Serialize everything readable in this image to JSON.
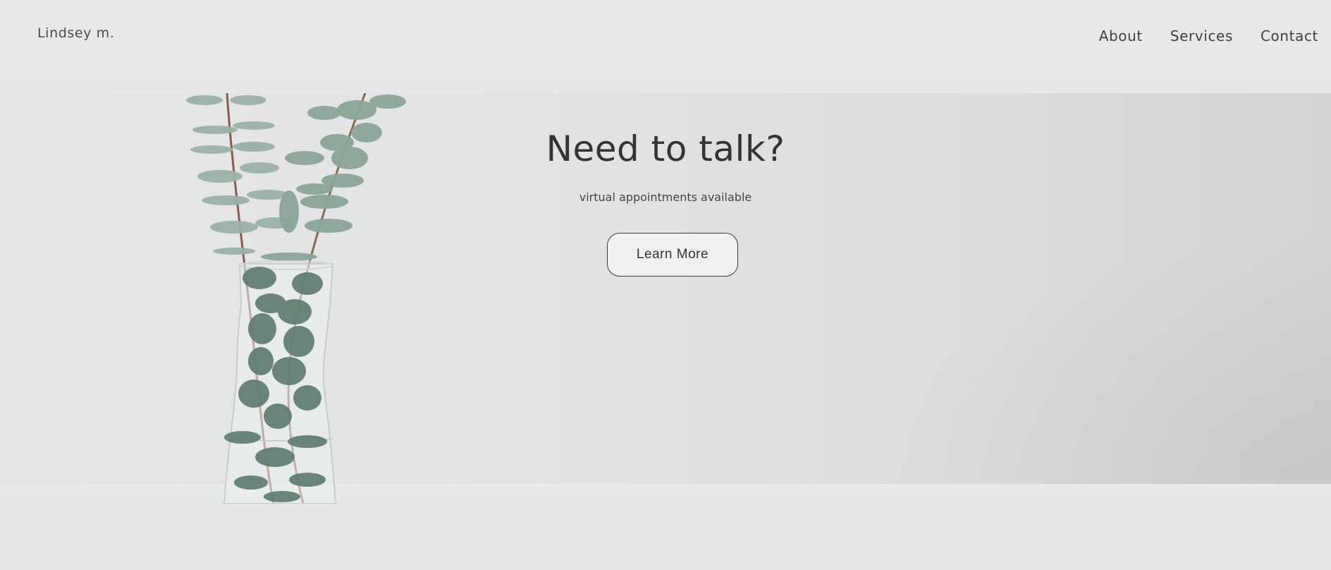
{
  "header": {
    "brand": "Lindsey m.",
    "nav": [
      "About",
      "Services",
      "Contact"
    ]
  },
  "hero": {
    "title": "Need to talk?",
    "subtitle": "virtual appointments available",
    "cta_label": "Learn More",
    "image": "eucalyptus-in-glass-vase"
  },
  "colors": {
    "background": "#e6e7e9",
    "text": "#333333",
    "leaf": "#7f9a8e",
    "button_border": "#3a3a3a"
  }
}
